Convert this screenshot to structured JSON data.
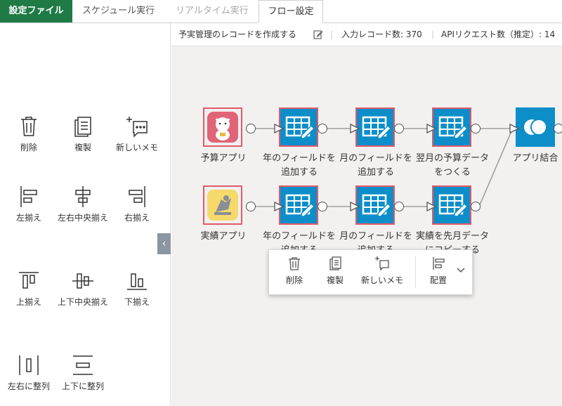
{
  "tabs": {
    "brand": "設定ファイル",
    "schedule": "スケジュール実行",
    "realtime": "リアルタイム実行",
    "flow": "フロー設定"
  },
  "toolbar": {
    "delete": "削除",
    "copy": "複製",
    "memo": "新しいメモ",
    "align_left": "左揃え",
    "align_hcenter": "左右中央揃え",
    "align_right": "右揃え",
    "align_top": "上揃え",
    "align_vcenter": "上下中央揃え",
    "align_bottom": "下揃え",
    "distribute_h": "左右に整列",
    "distribute_v": "上下に整列"
  },
  "infobar": {
    "flow_name": "予実管理のレコードを作成する",
    "input_records": "入力レコード数: 370",
    "api_requests": "APIリクエスト数（推定）: 14"
  },
  "nodes": {
    "budget_app": "予算アプリ",
    "year_field_1": "年のフィールドを追加する",
    "month_field_1": "月のフィールドを追加する",
    "next_month": "翌月の予算データをつくる",
    "join": "アプリ結合",
    "actual_app": "実績アプリ",
    "year_field_2": "年のフィールドを追加する",
    "month_field_2": "月のフィールドを追加する",
    "copy_prev": "実績を先月データにコピーする"
  },
  "popup": {
    "delete": "削除",
    "copy": "複製",
    "memo": "新しいメモ",
    "arrange": "配置"
  },
  "colors": {
    "brand": "#1f7a45",
    "node_blue": "#0d8ec9",
    "selection": "#e25a6a"
  }
}
